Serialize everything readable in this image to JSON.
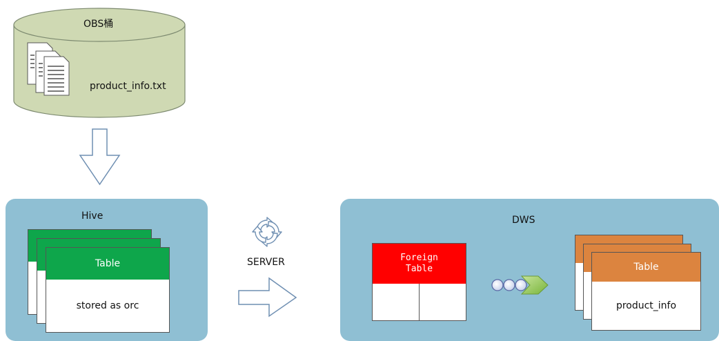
{
  "obs": {
    "title": "OBS桶",
    "file_name": "product_info.txt",
    "cylinder_color": "#cfd9b3",
    "files_icon": "document-stack-icon"
  },
  "hive": {
    "title": "Hive",
    "table_header": "Table",
    "table_body": "stored as orc",
    "header_color": "#0ea64b"
  },
  "server": {
    "label": "SERVER",
    "sync_icon": "sync-icon",
    "arrow_icon": "right-arrow-icon"
  },
  "dws": {
    "title": "DWS",
    "foreign_table_line1": "Foreign",
    "foreign_table_line2": "Table",
    "foreign_header_color": "#ff0000",
    "flow_icon": "data-flow-icon",
    "table_header": "Table",
    "table_body": "product_info",
    "header_color": "#dc843f"
  },
  "colors": {
    "panel": "#8fbfd3",
    "arrow_stroke": "#6f8fb2"
  }
}
